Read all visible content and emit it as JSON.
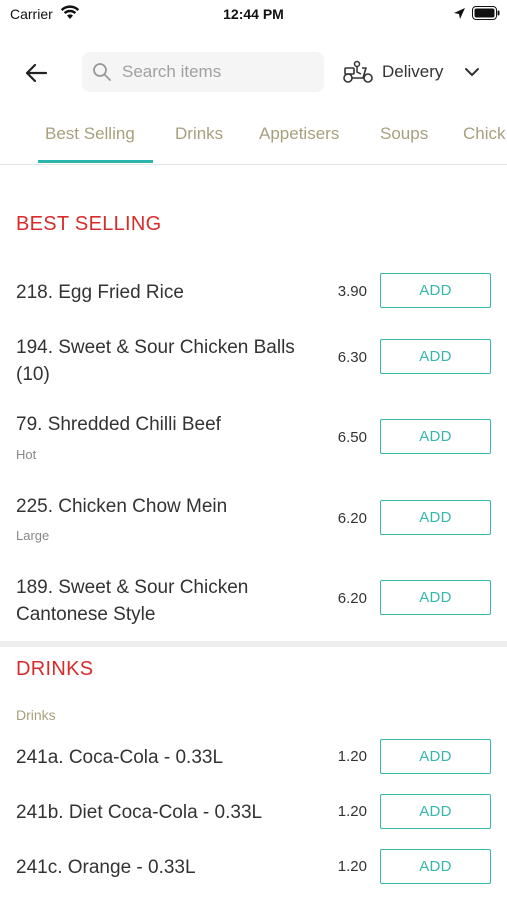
{
  "status_bar": {
    "carrier": "Carrier",
    "time": "12:44 PM"
  },
  "search": {
    "placeholder": "Search items"
  },
  "delivery": {
    "label": "Delivery"
  },
  "tabs": [
    "Best Selling",
    "Drinks",
    "Appetisers",
    "Soups",
    "Chick"
  ],
  "active_tab": "Best Selling",
  "colors": {
    "accent": "#2cb5ad",
    "section_title": "#d82c2c",
    "tab_text": "#a7a07e"
  },
  "best_selling": {
    "title": "BEST SELLING",
    "items": [
      {
        "name": "218. Egg Fried Rice",
        "desc": "",
        "price": "3.90",
        "button": "ADD"
      },
      {
        "name": "194. Sweet & Sour Chicken Balls (10)",
        "desc": "",
        "price": "6.30",
        "button": "ADD"
      },
      {
        "name": "79. Shredded Chilli Beef",
        "desc": "Hot",
        "price": "6.50",
        "button": "ADD"
      },
      {
        "name": "225. Chicken Chow Mein",
        "desc": "Large",
        "price": "6.20",
        "button": "ADD"
      },
      {
        "name": "189. Sweet & Sour Chicken Cantonese Style",
        "desc": "",
        "price": "6.20",
        "button": "ADD"
      }
    ]
  },
  "drinks": {
    "title": "DRINKS",
    "subheader": "Drinks",
    "items": [
      {
        "name": "241a. Coca-Cola - 0.33L",
        "price": "1.20",
        "button": "ADD"
      },
      {
        "name": "241b. Diet Coca-Cola - 0.33L",
        "price": "1.20",
        "button": "ADD"
      },
      {
        "name": "241c. Orange - 0.33L",
        "price": "1.20",
        "button": "ADD"
      }
    ]
  }
}
